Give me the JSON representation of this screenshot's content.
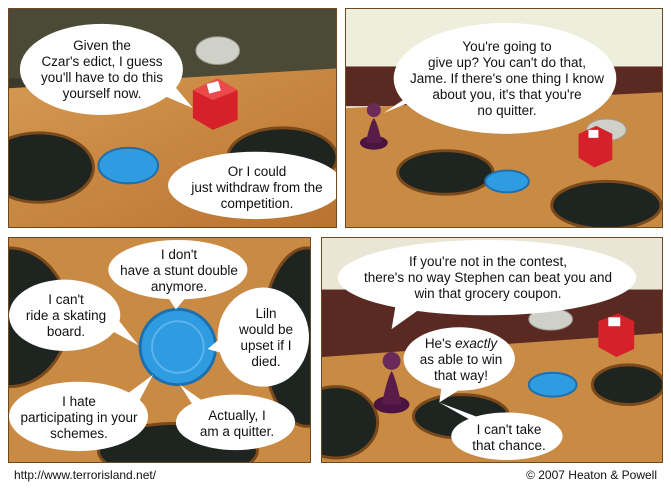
{
  "panels": [
    {
      "bubbles": [
        "Given the\nCzar's edict, I guess\nyou'll have to do this\nyourself now.",
        "Or I could\njust withdraw from the\ncompetition."
      ]
    },
    {
      "bubbles": [
        "You're going to\ngive up? You can't do that,\nJame. If there's one thing I know\nabout you, it's that you're\nno quitter."
      ]
    },
    {
      "bubbles": [
        "I don't\nhave a stunt double\nanymore.",
        "I can't\nride a skating\nboard.",
        "Liln\nwould be\nupset if I\ndied.",
        "I hate\nparticipating in your\nschemes.",
        "Actually, I\nam a quitter."
      ]
    },
    {
      "bubbles": [
        "If you're not in the contest,\nthere's no way Stephen can beat you and\nwin that grocery coupon.",
        "I can't take\nthat chance."
      ],
      "emphasis_bubble": {
        "before": "He's ",
        "emphasis": "exactly",
        "after": "\nas able to win\nthat way!"
      }
    }
  ],
  "footer": {
    "url": "http://www.terrorisland.net/",
    "copyright": "© 2007 Heaton & Powell"
  },
  "colors": {
    "wood": "#c8853f",
    "wood_dark": "#8a5522",
    "hole": "#1e2420",
    "chip_blue": "#2f9be0",
    "die_red": "#d6202a",
    "pawn_purple": "#5a1d4a",
    "coin_silver": "#cfd0c8",
    "bubble": "#ffffff"
  }
}
